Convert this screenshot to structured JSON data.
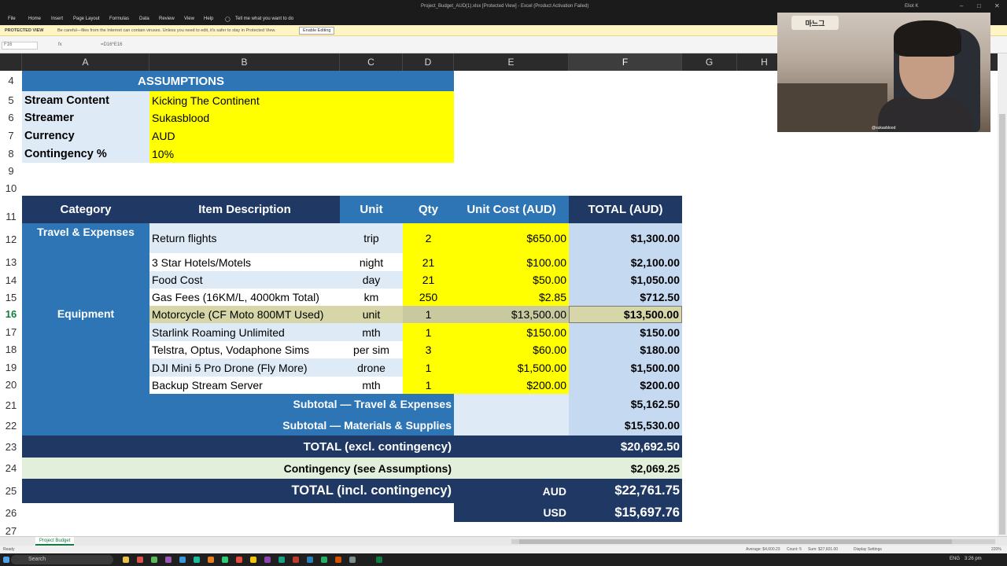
{
  "window": {
    "title": "Project_Budget_AUD(1).xlsx [Protected View] - Excel (Product Activation Failed)",
    "user": "Eliot K"
  },
  "ribbon_tabs": [
    "File",
    "Home",
    "Insert",
    "Page Layout",
    "Formulas",
    "Data",
    "Review",
    "View",
    "Help"
  ],
  "tell_me": "Tell me what you want to do",
  "protected_view": {
    "label": "PROTECTED VIEW",
    "message": "Be careful—files from the Internet can contain viruses. Unless you need to edit, it's safer to stay in Protected View.",
    "button": "Enable Editing"
  },
  "formula_bar": {
    "name_box": "F16",
    "formula": "=D16*E16"
  },
  "columns": [
    "A",
    "B",
    "C",
    "D",
    "E",
    "F",
    "G",
    "H"
  ],
  "rows": [
    "4",
    "5",
    "6",
    "7",
    "8",
    "9",
    "10",
    "11",
    "12",
    "13",
    "14",
    "15",
    "16",
    "17",
    "18",
    "19",
    "20",
    "21",
    "22",
    "23",
    "24",
    "25",
    "26",
    "27"
  ],
  "assumptions": {
    "header": "ASSUMPTIONS",
    "items": [
      {
        "label": "Stream Content",
        "value": "Kicking The Continent"
      },
      {
        "label": "Streamer",
        "value": "Sukasblood"
      },
      {
        "label": "Currency",
        "value": "AUD"
      },
      {
        "label": "Contingency %",
        "value": "10%"
      }
    ]
  },
  "table": {
    "headers": [
      "Category",
      "Item Description",
      "Unit",
      "Qty",
      "Unit Cost (AUD)",
      "TOTAL (AUD)"
    ],
    "categories": {
      "travel": "Travel & Expenses",
      "equipment": "Equipment"
    },
    "rows": [
      {
        "desc": "Return flights",
        "unit": "trip",
        "qty": "2",
        "cost": "$650.00",
        "total": "$1,300.00"
      },
      {
        "desc": "3 Star Hotels/Motels",
        "unit": "night",
        "qty": "21",
        "cost": "$100.00",
        "total": "$2,100.00"
      },
      {
        "desc": "Food Cost",
        "unit": "day",
        "qty": "21",
        "cost": "$50.00",
        "total": "$1,050.00"
      },
      {
        "desc": "Gas Fees (16KM/L, 4000km Total)",
        "unit": "km",
        "qty": "250",
        "cost": "$2.85",
        "total": "$712.50"
      },
      {
        "desc": "Motorcycle (CF Moto 800MT Used)",
        "unit": "unit",
        "qty": "1",
        "cost": "$13,500.00",
        "total": "$13,500.00"
      },
      {
        "desc": "Starlink Roaming Unlimited",
        "unit": "mth",
        "qty": "1",
        "cost": "$150.00",
        "total": "$150.00"
      },
      {
        "desc": "Telstra, Optus, Vodaphone Sims",
        "unit": "per sim",
        "qty": "3",
        "cost": "$60.00",
        "total": "$180.00"
      },
      {
        "desc": "DJI Mini 5 Pro Drone (Fly More)",
        "unit": "drone",
        "qty": "1",
        "cost": "$1,500.00",
        "total": "$1,500.00"
      },
      {
        "desc": "Backup Stream Server",
        "unit": "mth",
        "qty": "1",
        "cost": "$200.00",
        "total": "$200.00"
      }
    ],
    "subtotal_travel_label": "Subtotal — Travel & Expenses",
    "subtotal_travel": "$5,162.50",
    "subtotal_materials_label": "Subtotal — Materials & Supplies",
    "subtotal_materials": "$15,530.00",
    "total_excl_label": "TOTAL (excl. contingency)",
    "total_excl": "$20,692.50",
    "contingency_label": "Contingency (see Assumptions)",
    "contingency": "$2,069.25",
    "total_incl_label": "TOTAL (incl. contingency)",
    "aud_label": "AUD",
    "total_aud": "$22,761.75",
    "usd_label": "USD",
    "total_usd": "$15,697.76"
  },
  "webcam": {
    "logo_text": "마느그",
    "handle": "@sukasblood"
  },
  "sheet_tab": "Project Budget",
  "status": {
    "ready": "Ready",
    "average": "Average: $4,600.23",
    "count": "Count: 5",
    "sum": "Sum: $27,601.00",
    "display": "Display Settings",
    "zoom": "220%"
  },
  "taskbar": {
    "search": "Search",
    "lang": "ENG",
    "time": "3:26 pm"
  },
  "colors": {
    "navy": "#203864",
    "blue": "#2e75b6",
    "yellow": "#ffff00",
    "light_blue": "#deeaf6",
    "excel_green": "#107c41"
  }
}
